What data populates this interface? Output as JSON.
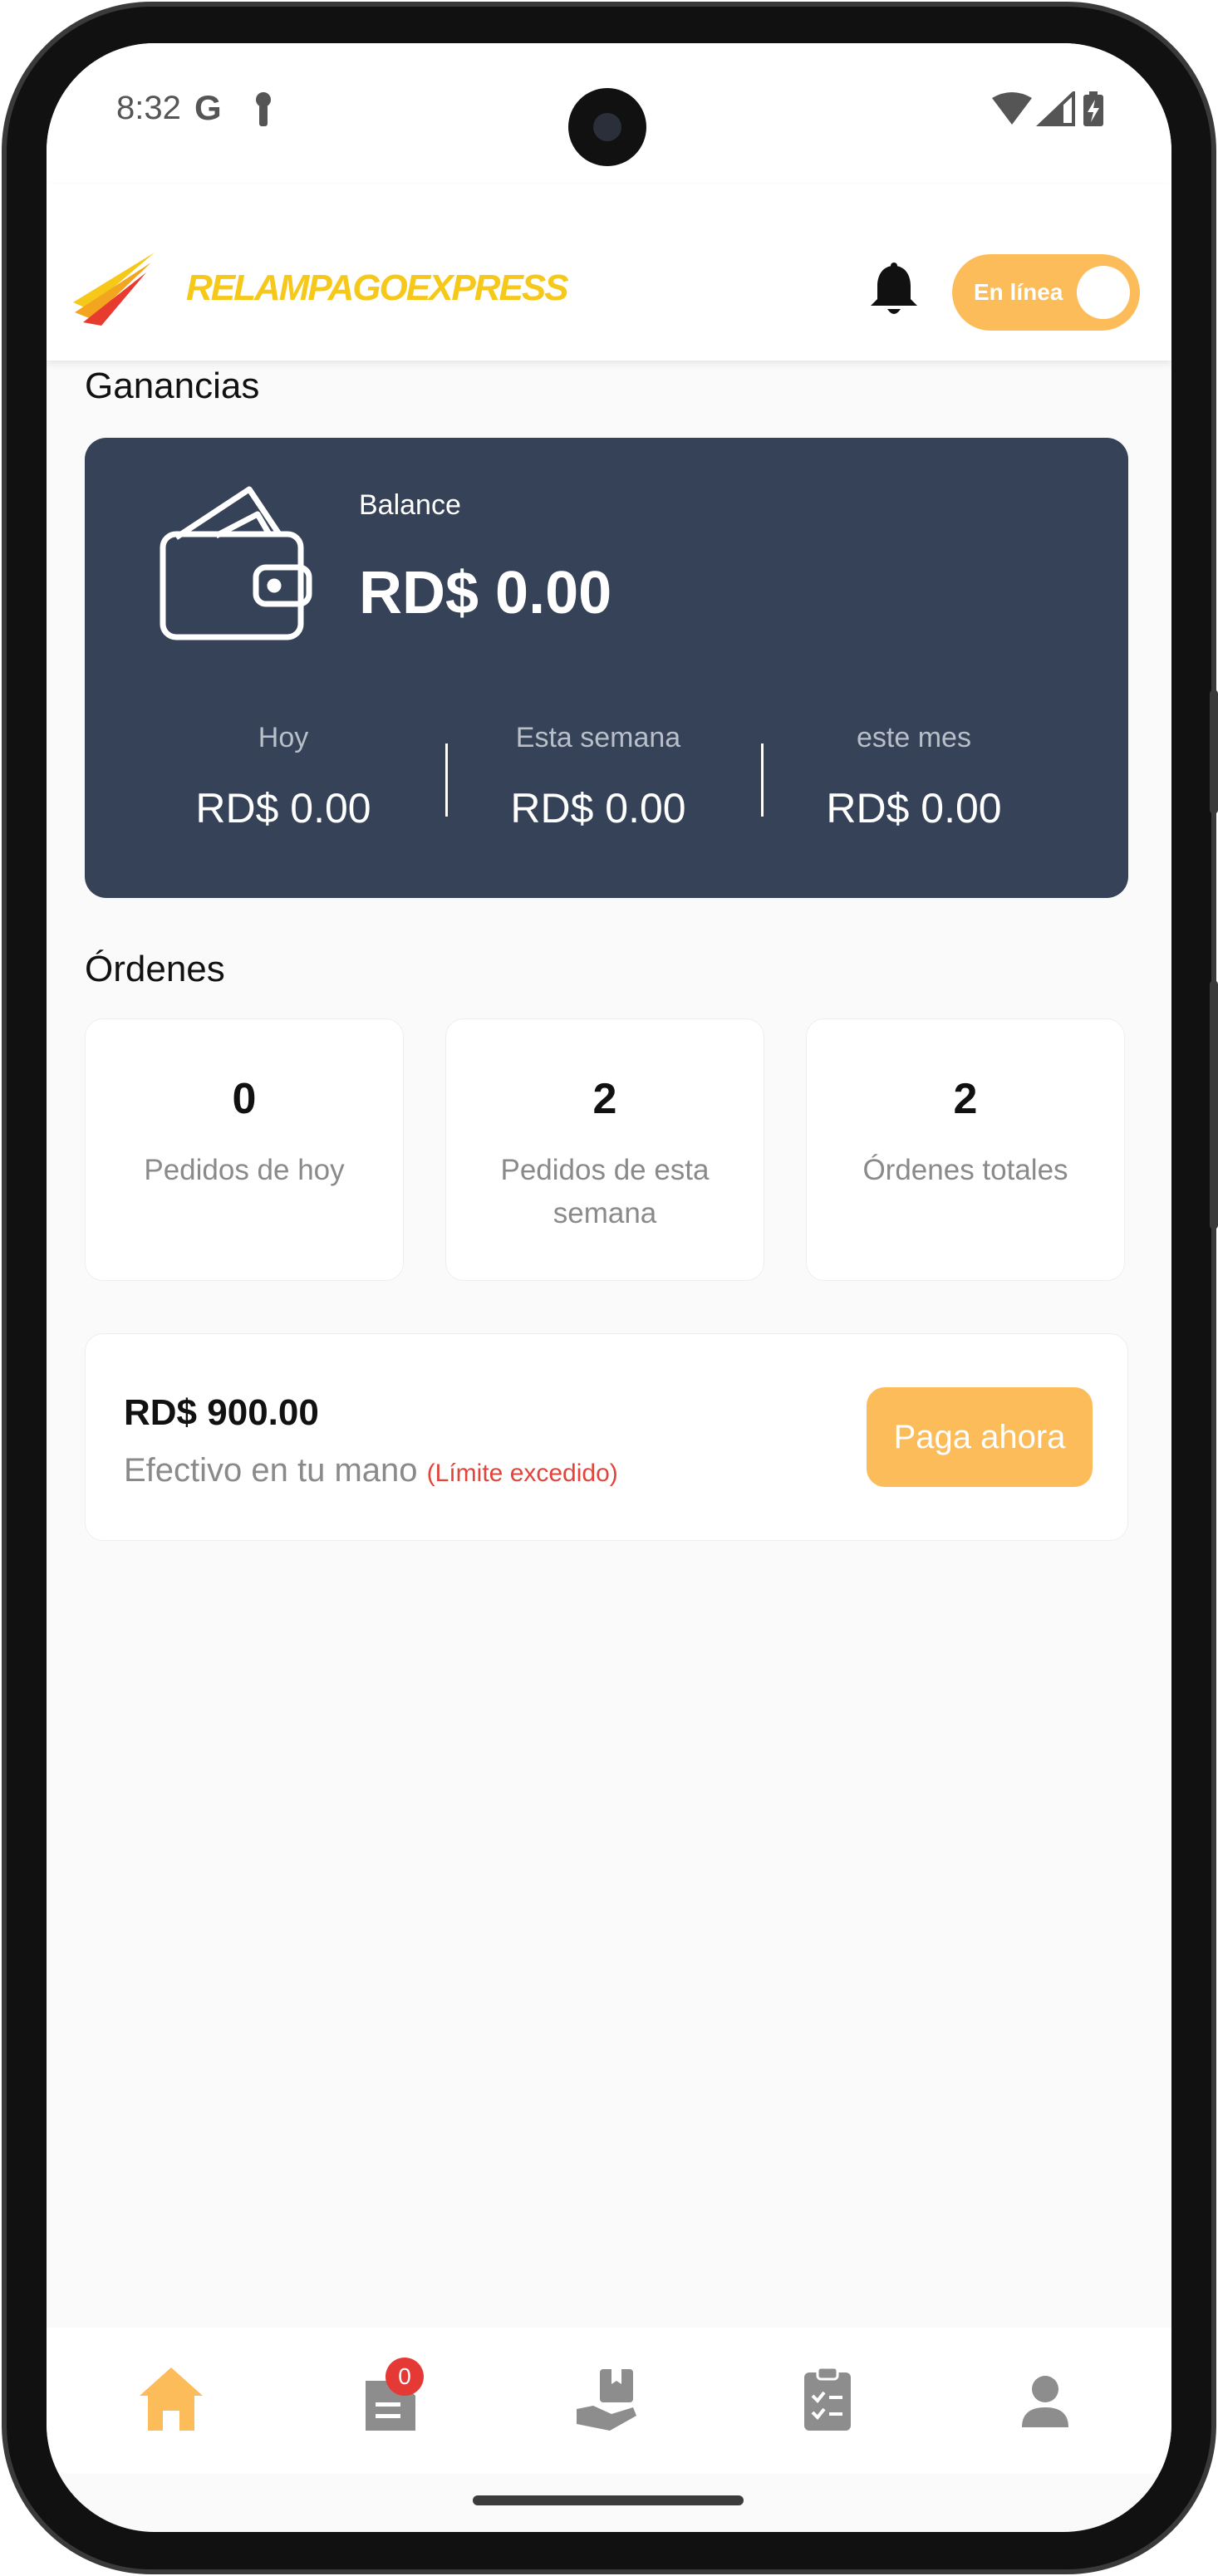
{
  "status_bar": {
    "time": "8:32",
    "google_glyph": "G",
    "icons": [
      "key-icon",
      "wifi-icon",
      "signal-icon",
      "battery-charging-icon"
    ]
  },
  "header": {
    "brand_name": "RELAMPAGOEXPRESS",
    "brand_color": "#f6c81a",
    "online_toggle_label": "En línea",
    "online_toggle_on": true,
    "accent_color": "#fdbc5a"
  },
  "earnings": {
    "section_title": "Ganancias",
    "balance_label": "Balance",
    "balance_value": "RD$ 0.00",
    "card_color": "#354257",
    "periods": [
      {
        "label": "Hoy",
        "value": "RD$ 0.00"
      },
      {
        "label": "Esta semana",
        "value": "RD$ 0.00"
      },
      {
        "label": "este mes",
        "value": "RD$ 0.00"
      }
    ]
  },
  "orders": {
    "section_title": "Órdenes",
    "cards": [
      {
        "count": "0",
        "label": "Pedidos de hoy"
      },
      {
        "count": "2",
        "label": "Pedidos de esta semana"
      },
      {
        "count": "2",
        "label": "Órdenes totales"
      }
    ]
  },
  "cash": {
    "amount": "RD$ 900.00",
    "label": "Efectivo en tu mano",
    "warning": "(Límite excedido)",
    "warning_color": "#e0453c",
    "pay_button_label": "Paga ahora"
  },
  "bottom_nav": {
    "items": [
      "home-icon",
      "orders-list-icon",
      "delivery-hand-icon",
      "clipboard-check-icon",
      "profile-icon"
    ],
    "active": "home-icon",
    "orders_badge": "0"
  }
}
